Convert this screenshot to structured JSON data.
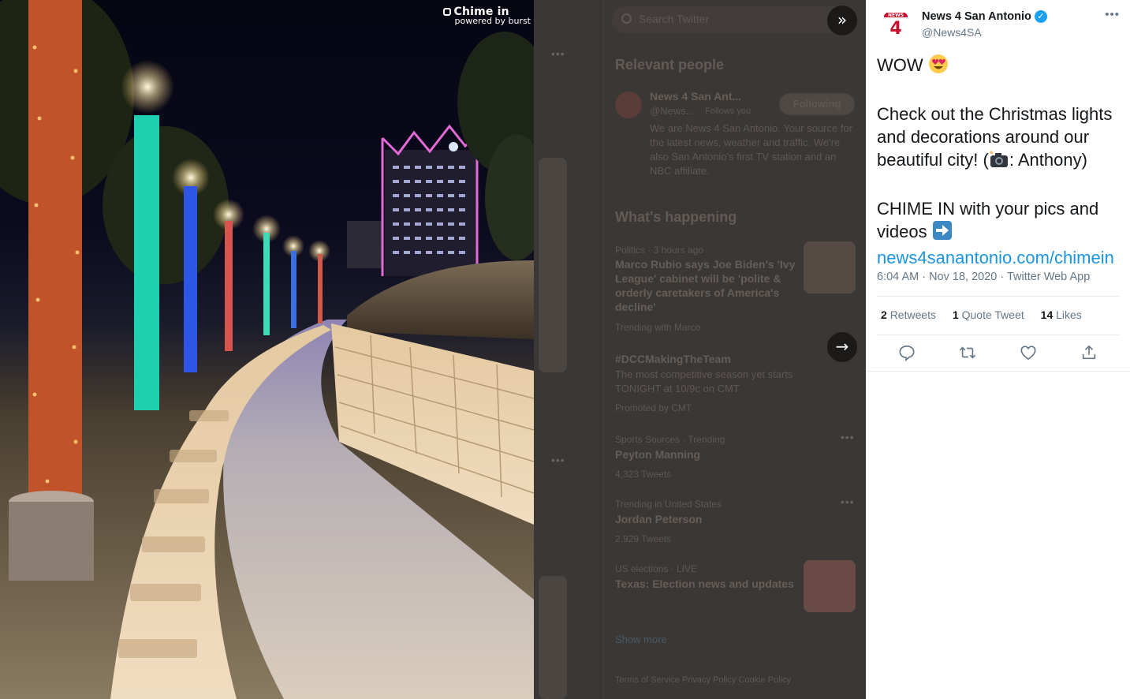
{
  "photo": {
    "watermark_brand": "Chime in",
    "watermark_sub": "powered by burst"
  },
  "background": {
    "search_placeholder": "Search Twitter",
    "relevant_people_heading": "Relevant people",
    "relevant_name": "News 4 San Ant...",
    "relevant_handle": "@News...",
    "relevant_follows": "Follows you",
    "relevant_follow_btn": "Following",
    "relevant_bio": "We are News 4 San Antonio. Your source for the latest news, weather and traffic. We're also San Antonio's first TV station and an NBC affiliate.",
    "whats_happening_heading": "What's happening",
    "trends": [
      {
        "meta": "Politics · 3 hours ago",
        "title": "Marco Rubio says Joe Biden's 'Ivy League' cabinet will be 'polite & orderly caretakers of America's decline'",
        "sub": "Trending with Marco"
      },
      {
        "meta": "",
        "title": "#DCCMakingTheTeam",
        "sub": "The most competitive season yet starts TONIGHT at 10/9c on CMT",
        "promoted": "Promoted by CMT"
      },
      {
        "meta": "Sports Sources · Trending",
        "title": "Peyton Manning",
        "sub": "4,323 Tweets"
      },
      {
        "meta": "Trending in United States",
        "title": "Jordan Peterson",
        "sub": "2,929 Tweets"
      },
      {
        "meta": "US elections · LIVE",
        "title": "Texas: Election news and updates",
        "sub": ""
      }
    ],
    "show_more": "Show more",
    "footer_links": "Terms of Service  Privacy Policy  Cookie Policy"
  },
  "tweet": {
    "display_name": "News 4 San Antonio",
    "handle": "@News4SA",
    "verified_mark": "✓",
    "more_label": "•••",
    "line1": "WOW",
    "line2a": "Check out the Christmas lights and decorations around our beautiful city! (",
    "line2b": ": Anthony)",
    "line3": "CHIME IN with your pics and videos",
    "link": "news4sanantonio.com/chimein",
    "timestamp": "6:04 AM · Nov 18, 2020 · Twitter Web App",
    "retweets_count": "2",
    "retweets_label": "Retweets",
    "quotes_count": "1",
    "quotes_label": "Quote Tweet",
    "likes_count": "14",
    "likes_label": "Likes"
  },
  "icons": {
    "collapse": "»",
    "next": "→",
    "verified": "verified-badge-icon",
    "reply": "reply-icon",
    "retweet": "retweet-icon",
    "like": "heart-icon",
    "share": "share-icon"
  },
  "colors": {
    "link": "#1b95e0",
    "verified": "#1da1f2",
    "secondary_text": "#657786"
  }
}
